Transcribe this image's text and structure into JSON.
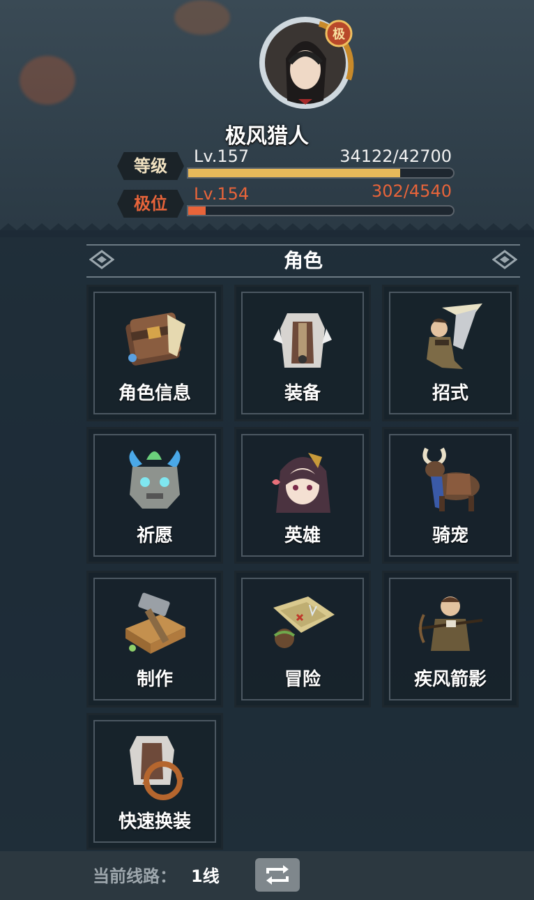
{
  "header": {
    "character_name": "极风猎人",
    "level": {
      "label": "等级",
      "value": "Lv.157",
      "exp": "34122/42700",
      "progress": 0.799
    },
    "rank": {
      "label": "极位",
      "value": "Lv.154",
      "exp": "302/4540",
      "progress": 0.067
    },
    "avatar_badge": "极"
  },
  "section": {
    "title": "角色"
  },
  "menu": [
    {
      "label": "角色信息",
      "icon": "book-icon"
    },
    {
      "label": "装备",
      "icon": "armor-icon"
    },
    {
      "label": "招式",
      "icon": "warrior-icon"
    },
    {
      "label": "祈愿",
      "icon": "stone-mask-icon"
    },
    {
      "label": "英雄",
      "icon": "hero-girl-icon"
    },
    {
      "label": "骑宠",
      "icon": "mount-bull-icon"
    },
    {
      "label": "制作",
      "icon": "hammer-icon"
    },
    {
      "label": "冒险",
      "icon": "treasure-map-icon"
    },
    {
      "label": "疾风箭影",
      "icon": "archer-icon"
    },
    {
      "label": "快速换装",
      "icon": "quick-swap-icon"
    }
  ],
  "footer": {
    "line_label": "当前线路：",
    "line_value": "1线",
    "refresh_icon": "refresh-icon"
  },
  "colors": {
    "gold": "#e7b95a",
    "orange": "#e8643a",
    "panel": "#1c2a34"
  }
}
